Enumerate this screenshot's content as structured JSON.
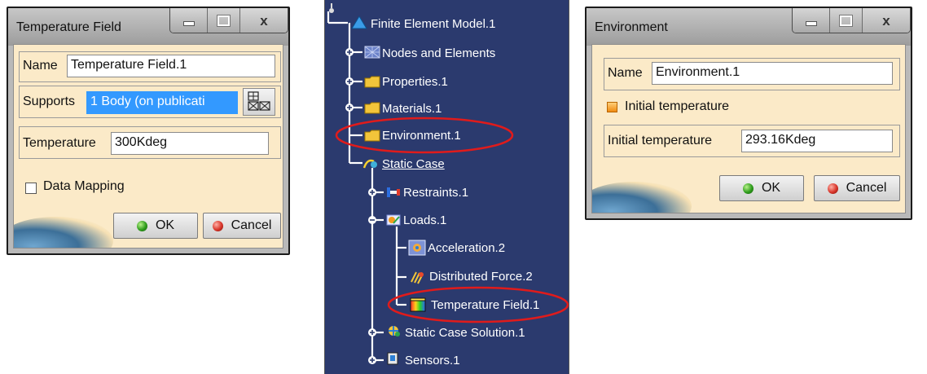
{
  "temp_dialog": {
    "title": "Temperature Field",
    "name_label": "Name",
    "name_value": "Temperature Field.1",
    "supports_label": "Supports",
    "supports_value": "1 Body (on publicati",
    "temperature_label": "Temperature",
    "temperature_value": "300Kdeg",
    "data_mapping_label": "Data Mapping",
    "ok_label": "OK",
    "cancel_label": "Cancel"
  },
  "tree": {
    "root": "Finite Element Model.1",
    "items": [
      {
        "label": "Nodes and Elements",
        "icon": "mesh-icon"
      },
      {
        "label": "Properties.1",
        "icon": "folder-icon"
      },
      {
        "label": "Materials.1",
        "icon": "folder-icon"
      },
      {
        "label": "Environment.1",
        "icon": "folder-icon",
        "highlighted": true
      },
      {
        "label": "Static Case",
        "icon": "static-case-icon"
      },
      {
        "label": "Restraints.1",
        "icon": "restraint-icon"
      },
      {
        "label": "Loads.1",
        "icon": "loads-icon"
      },
      {
        "label": "Acceleration.2",
        "icon": "acceleration-icon"
      },
      {
        "label": "Distributed Force.2",
        "icon": "distributed-force-icon"
      },
      {
        "label": "Temperature Field.1",
        "icon": "temperature-field-icon",
        "highlighted": true
      },
      {
        "label": "Static Case Solution.1",
        "icon": "solution-icon"
      },
      {
        "label": "Sensors.1",
        "icon": "sensor-icon"
      }
    ],
    "highlight_color": "#e01b1b"
  },
  "env_dialog": {
    "title": "Environment",
    "name_label": "Name",
    "name_value": "Environment.1",
    "initial_temp_check_label": "Initial temperature",
    "initial_temp_label": "Initial temperature",
    "initial_temp_value": "293.16Kdeg",
    "ok_label": "OK",
    "cancel_label": "Cancel"
  }
}
